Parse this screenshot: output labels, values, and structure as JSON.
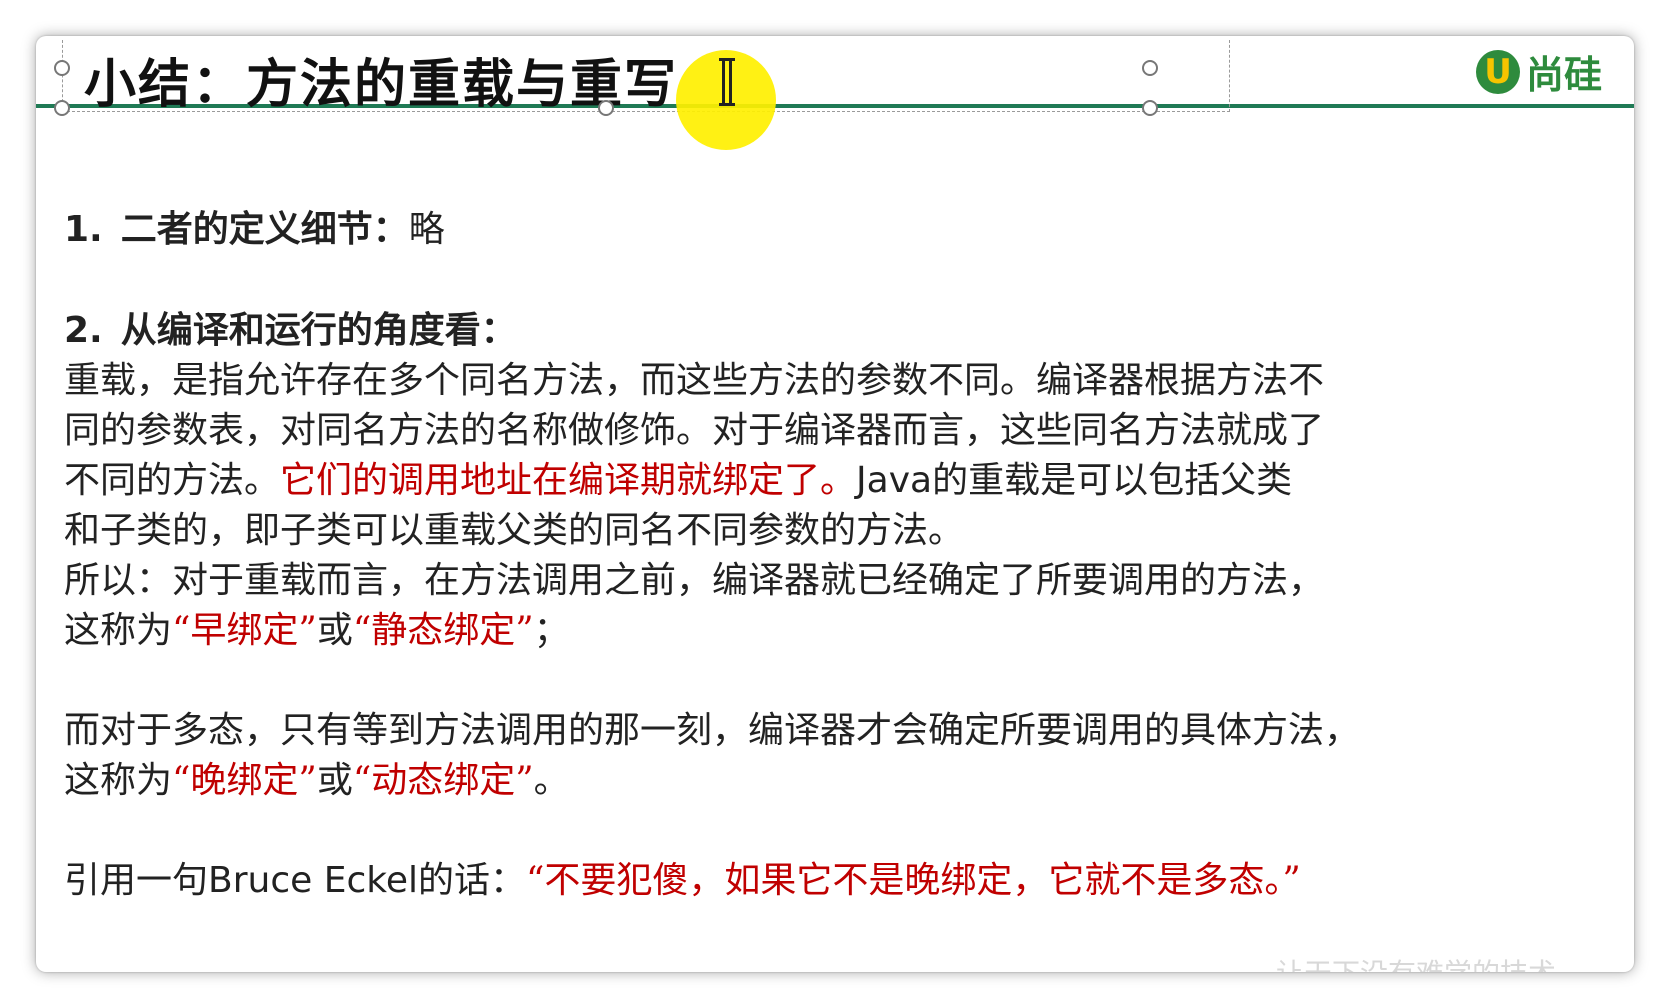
{
  "slide": {
    "title": "小结：方法的重载与重写",
    "logo_mark": "U",
    "logo_text": "尚硅",
    "colors": {
      "accent_rule": "#1f7a55",
      "emphasis_red": "#c00000",
      "logo_green": "#2e8b3d",
      "cursor_highlight": "#fff000"
    }
  },
  "content": {
    "item1": {
      "number": "1.",
      "label": "二者的定义细节：",
      "value": "略"
    },
    "item2": {
      "number": "2.",
      "label": "从编译和运行的角度看："
    },
    "para1": {
      "line1": "重载，是指允许存在多个同名方法，而这些方法的参数不同。编译器根据方法不",
      "line2": "同的参数表，对同名方法的名称做修饰。对于编译器而言，这些同名方法就成了",
      "line3_pre": "不同的方法。",
      "line3_red": "它们的调用地址在编译期就绑定了。",
      "line3_java": "Java",
      "line3_post": "的重载是可以包括父类",
      "line4": "和子类的，即子类可以重载父类的同名不同参数的方法。"
    },
    "para2": {
      "line1": "所以：对于重载而言，在方法调用之前，编译器就已经确定了所要调用的方法，",
      "line2_pre": "这称为",
      "line2_red1": "“早绑定”",
      "line2_mid": "或",
      "line2_red2": "“静态绑定”",
      "line2_post": "；"
    },
    "para3": {
      "line1": "而对于多态，只有等到方法调用的那一刻，编译器才会确定所要调用的具体方法，",
      "line2_pre": "这称为",
      "line2_red1": "“晚绑定”",
      "line2_mid": "或",
      "line2_red2": "“动态绑定”",
      "line2_post": "。"
    },
    "quote": {
      "pre": "引用一句",
      "author": "Bruce Eckel",
      "mid": "的话：",
      "text": "“不要犯傻，如果它不是晚绑定，它就不是多态。”"
    }
  },
  "watermark": "让天下没有难学的技术"
}
